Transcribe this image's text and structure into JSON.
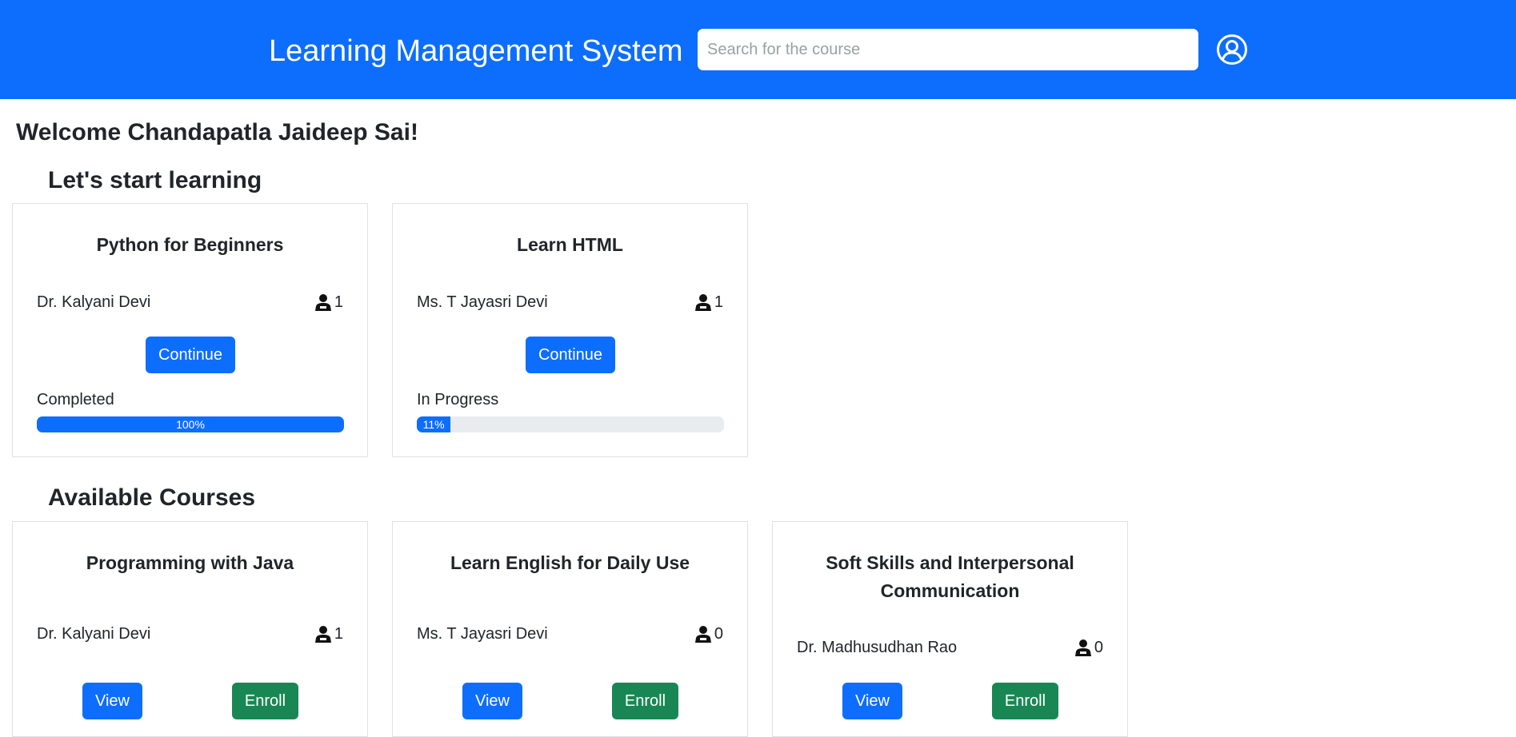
{
  "header": {
    "brand": "Learning Management System",
    "search_placeholder": "Search for the course",
    "profile_icon": "user-circle-icon"
  },
  "welcome": "Welcome Chandapatla Jaideep Sai!",
  "sections": {
    "learning_title": "Let's start learning",
    "available_title": "Available Courses"
  },
  "my_courses": [
    {
      "title": "Python for Beginners",
      "instructor": "Dr. Kalyani Devi",
      "enrolled": "1",
      "button": "Continue",
      "status": "Completed",
      "progress": 100,
      "progress_label": "100%"
    },
    {
      "title": "Learn HTML",
      "instructor": "Ms. T Jayasri Devi",
      "enrolled": "1",
      "button": "Continue",
      "status": "In Progress",
      "progress": 11,
      "progress_label": "11%"
    }
  ],
  "available_courses": [
    {
      "title": "Programming with Java",
      "instructor": "Dr. Kalyani Devi",
      "enrolled": "1",
      "view": "View",
      "enroll": "Enroll"
    },
    {
      "title": "Learn English for Daily Use",
      "instructor": "Ms. T Jayasri Devi",
      "enrolled": "0",
      "view": "View",
      "enroll": "Enroll"
    },
    {
      "title": "Soft Skills and Interpersonal Communication",
      "instructor": "Dr. Madhusudhan Rao",
      "enrolled": "0",
      "view": "View",
      "enroll": "Enroll"
    }
  ],
  "colors": {
    "primary": "#0d6efd",
    "success": "#198754",
    "progress_track": "#e9ecef"
  }
}
